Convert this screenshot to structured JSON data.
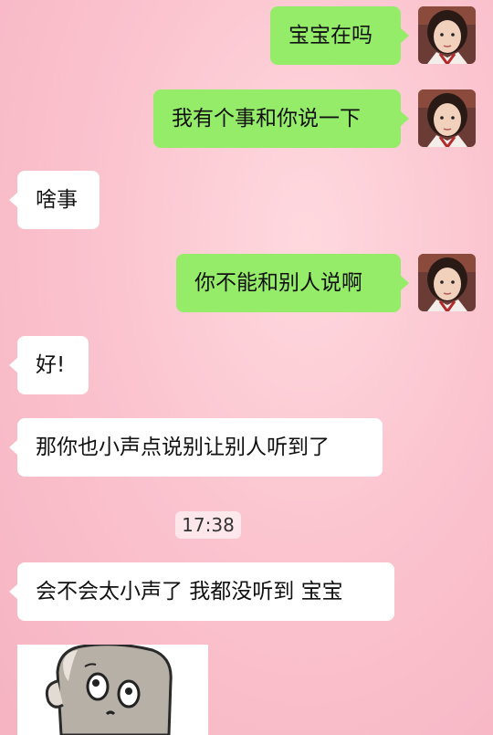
{
  "messages": [
    {
      "side": "out",
      "text": "宝宝在吗"
    },
    {
      "side": "out",
      "text": "我有个事和你说一下"
    },
    {
      "side": "in",
      "text": "啥事"
    },
    {
      "side": "out",
      "text": "你不能和别人说啊"
    },
    {
      "side": "in",
      "text": "好!"
    },
    {
      "side": "in",
      "text": "那你也小声点说别让别人听到了"
    },
    {
      "side": "in",
      "text": "会不会太小声了 我都没听到 宝宝"
    }
  ],
  "timestamp": "17:38",
  "colors": {
    "outgoing_bubble": "#95ec69",
    "incoming_bubble": "#ffffff",
    "background": "#f8bccb"
  },
  "icons": {
    "self_avatar": "girl-photo-avatar",
    "sticker": "cartoon-face-sticker"
  }
}
